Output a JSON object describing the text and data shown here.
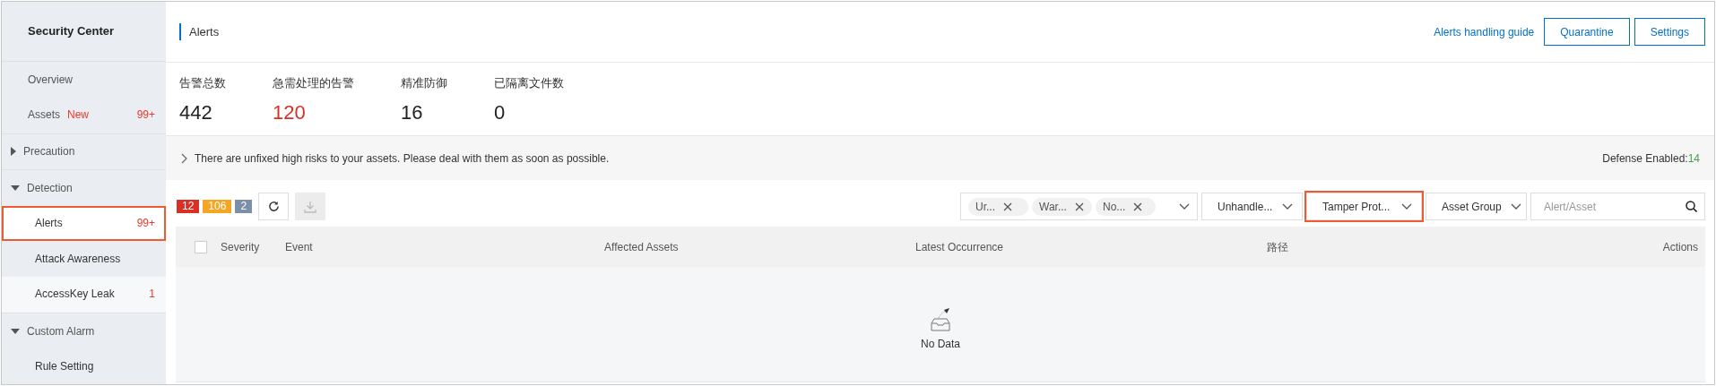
{
  "sidebar": {
    "title": "Security Center",
    "items": [
      {
        "kind": "link",
        "label": "Overview",
        "selected": false,
        "hovered": false
      },
      {
        "kind": "link",
        "label": "Assets",
        "tag": "New",
        "count": "99+",
        "selected": false,
        "hovered": false
      },
      {
        "kind": "group",
        "label": "Precaution",
        "expanded": false
      },
      {
        "kind": "group",
        "label": "Detection",
        "expanded": true,
        "children": [
          {
            "kind": "link",
            "label": "Alerts",
            "count": "99+",
            "selected": true,
            "hovered": false,
            "highlighted": true
          },
          {
            "kind": "link",
            "label": "Attack Awareness",
            "selected": false,
            "hovered": false
          },
          {
            "kind": "link",
            "label": "AccessKey Leak",
            "count": "1",
            "selected": false,
            "hovered": true
          }
        ]
      },
      {
        "kind": "group",
        "label": "Custom Alarm",
        "expanded": true,
        "children": [
          {
            "kind": "link",
            "label": "Rule Setting",
            "selected": false,
            "hovered": false
          }
        ]
      }
    ]
  },
  "header": {
    "title": "Alerts",
    "guide_link": "Alerts handling guide",
    "buttons": [
      "Quarantine",
      "Settings"
    ]
  },
  "stats": [
    {
      "label": "告警总数",
      "value": "442",
      "urgent": false
    },
    {
      "label": "急需处理的告警",
      "value": "120",
      "urgent": true
    },
    {
      "label": "精准防御",
      "value": "16",
      "urgent": false
    },
    {
      "label": "已隔离文件数",
      "value": "0",
      "urgent": false
    }
  ],
  "banner": {
    "message": "There are unfixed high risks to your assets. Please deal with them as soon as possible.",
    "defense_label": "Defense Enabled:",
    "defense_value": "14"
  },
  "severity_counts": [
    {
      "value": "12",
      "color": "#d93026"
    },
    {
      "value": "106",
      "color": "#f5a623"
    },
    {
      "value": "2",
      "color": "#7b8fa6"
    }
  ],
  "toolbar": {
    "download_disabled": true
  },
  "filters": {
    "tags": [
      "Ur...",
      "War...",
      "No..."
    ],
    "dropdowns": [
      {
        "label": "Unhandle...",
        "highlighted": false
      },
      {
        "label": "Tamper Prot...",
        "highlighted": true
      },
      {
        "label": "Asset Group",
        "highlighted": false
      }
    ],
    "search": {
      "placeholder": "Alert/Asset"
    }
  },
  "table": {
    "select_all_checked": false,
    "columns": [
      "Severity",
      "Event",
      "Affected Assets",
      "Latest Occurrence",
      "路径",
      "Actions"
    ],
    "empty_text": "No Data"
  }
}
